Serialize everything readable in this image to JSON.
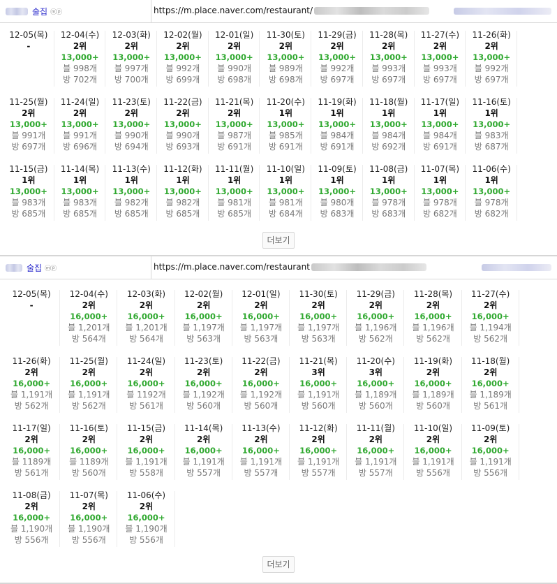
{
  "panels": [
    {
      "name": "술집",
      "badge": "ⓜⓟ",
      "url": "https://m.place.naver.com/restaurant/",
      "more_label": "더보기",
      "rows": [
        [
          {
            "date": "12-05(목)",
            "rank": "-",
            "price": "",
            "blog": "",
            "visit": ""
          },
          {
            "date": "12-04(수)",
            "rank": "2위",
            "price": "13,000+",
            "blog": "블 998개",
            "visit": "방 702개"
          },
          {
            "date": "12-03(화)",
            "rank": "2위",
            "price": "13,000+",
            "blog": "블 997개",
            "visit": "방 700개"
          },
          {
            "date": "12-02(월)",
            "rank": "2위",
            "price": "13,000+",
            "blog": "블 992개",
            "visit": "방 699개"
          },
          {
            "date": "12-01(일)",
            "rank": "2위",
            "price": "13,000+",
            "blog": "블 990개",
            "visit": "방 698개"
          },
          {
            "date": "11-30(토)",
            "rank": "2위",
            "price": "13,000+",
            "blog": "블 989개",
            "visit": "방 698개"
          },
          {
            "date": "11-29(금)",
            "rank": "2위",
            "price": "13,000+",
            "blog": "블 992개",
            "visit": "방 697개"
          },
          {
            "date": "11-28(목)",
            "rank": "2위",
            "price": "13,000+",
            "blog": "블 993개",
            "visit": "방 697개"
          },
          {
            "date": "11-27(수)",
            "rank": "2위",
            "price": "13,000+",
            "blog": "블 993개",
            "visit": "방 697개"
          },
          {
            "date": "11-26(화)",
            "rank": "2위",
            "price": "13,000+",
            "blog": "블 992개",
            "visit": "방 697개"
          }
        ],
        [
          {
            "date": "11-25(월)",
            "rank": "2위",
            "price": "13,000+",
            "blog": "블 991개",
            "visit": "방 697개"
          },
          {
            "date": "11-24(일)",
            "rank": "2위",
            "price": "13,000+",
            "blog": "블 991개",
            "visit": "방 696개"
          },
          {
            "date": "11-23(토)",
            "rank": "2위",
            "price": "13,000+",
            "blog": "블 990개",
            "visit": "방 694개"
          },
          {
            "date": "11-22(금)",
            "rank": "2위",
            "price": "13,000+",
            "blog": "블 990개",
            "visit": "방 693개"
          },
          {
            "date": "11-21(목)",
            "rank": "2위",
            "price": "13,000+",
            "blog": "블 987개",
            "visit": "방 691개"
          },
          {
            "date": "11-20(수)",
            "rank": "1위",
            "price": "13,000+",
            "blog": "블 985개",
            "visit": "방 691개"
          },
          {
            "date": "11-19(화)",
            "rank": "1위",
            "price": "13,000+",
            "blog": "블 984개",
            "visit": "방 691개"
          },
          {
            "date": "11-18(월)",
            "rank": "1위",
            "price": "13,000+",
            "blog": "블 984개",
            "visit": "방 692개"
          },
          {
            "date": "11-17(일)",
            "rank": "1위",
            "price": "13,000+",
            "blog": "블 984개",
            "visit": "방 691개"
          },
          {
            "date": "11-16(토)",
            "rank": "1위",
            "price": "13,000+",
            "blog": "블 983개",
            "visit": "방 687개"
          }
        ],
        [
          {
            "date": "11-15(금)",
            "rank": "1위",
            "price": "13,000+",
            "blog": "블 983개",
            "visit": "방 685개"
          },
          {
            "date": "11-14(목)",
            "rank": "1위",
            "price": "13,000+",
            "blog": "블 983개",
            "visit": "방 685개"
          },
          {
            "date": "11-13(수)",
            "rank": "1위",
            "price": "13,000+",
            "blog": "블 982개",
            "visit": "방 685개"
          },
          {
            "date": "11-12(화)",
            "rank": "1위",
            "price": "13,000+",
            "blog": "블 982개",
            "visit": "방 685개"
          },
          {
            "date": "11-11(월)",
            "rank": "1위",
            "price": "13,000+",
            "blog": "블 981개",
            "visit": "방 685개"
          },
          {
            "date": "11-10(일)",
            "rank": "1위",
            "price": "13,000+",
            "blog": "블 981개",
            "visit": "방 684개"
          },
          {
            "date": "11-09(토)",
            "rank": "1위",
            "price": "13,000+",
            "blog": "블 980개",
            "visit": "방 683개"
          },
          {
            "date": "11-08(금)",
            "rank": "1위",
            "price": "13,000+",
            "blog": "블 978개",
            "visit": "방 683개"
          },
          {
            "date": "11-07(목)",
            "rank": "1위",
            "price": "13,000+",
            "blog": "블 978개",
            "visit": "방 682개"
          },
          {
            "date": "11-06(수)",
            "rank": "1위",
            "price": "13,000+",
            "blog": "블 978개",
            "visit": "방 682개"
          }
        ]
      ]
    },
    {
      "name": "술집",
      "badge": "ⓜⓟ",
      "url": "https://m.place.naver.com/restaurant",
      "more_label": "더보기",
      "rows": [
        [
          {
            "date": "12-05(목)",
            "rank": "-",
            "price": "",
            "blog": "",
            "visit": ""
          },
          {
            "date": "12-04(수)",
            "rank": "2위",
            "price": "16,000+",
            "blog": "블 1,201개",
            "visit": "방 564개"
          },
          {
            "date": "12-03(화)",
            "rank": "2위",
            "price": "16,000+",
            "blog": "블 1,201개",
            "visit": "방 564개"
          },
          {
            "date": "12-02(월)",
            "rank": "2위",
            "price": "16,000+",
            "blog": "블 1,197개",
            "visit": "방 563개"
          },
          {
            "date": "12-01(일)",
            "rank": "2위",
            "price": "16,000+",
            "blog": "블 1,197개",
            "visit": "방 563개"
          },
          {
            "date": "11-30(토)",
            "rank": "2위",
            "price": "16,000+",
            "blog": "블 1,197개",
            "visit": "방 563개"
          },
          {
            "date": "11-29(금)",
            "rank": "2위",
            "price": "16,000+",
            "blog": "블 1,196개",
            "visit": "방 562개"
          },
          {
            "date": "11-28(목)",
            "rank": "2위",
            "price": "16,000+",
            "blog": "블 1,196개",
            "visit": "방 562개"
          },
          {
            "date": "11-27(수)",
            "rank": "2위",
            "price": "16,000+",
            "blog": "블 1,194개",
            "visit": "방 562개"
          }
        ],
        [
          {
            "date": "11-26(화)",
            "rank": "2위",
            "price": "16,000+",
            "blog": "블 1,191개",
            "visit": "방 562개"
          },
          {
            "date": "11-25(월)",
            "rank": "2위",
            "price": "16,000+",
            "blog": "블 1,191개",
            "visit": "방 562개"
          },
          {
            "date": "11-24(일)",
            "rank": "2위",
            "price": "16,000+",
            "blog": "블 1192개",
            "visit": "방 561개"
          },
          {
            "date": "11-23(토)",
            "rank": "2위",
            "price": "16,000+",
            "blog": "블 1,192개",
            "visit": "방 560개"
          },
          {
            "date": "11-22(금)",
            "rank": "2위",
            "price": "16,000+",
            "blog": "블 1,192개",
            "visit": "방 560개"
          },
          {
            "date": "11-21(목)",
            "rank": "3위",
            "price": "16,000+",
            "blog": "블 1,191개",
            "visit": "방 560개"
          },
          {
            "date": "11-20(수)",
            "rank": "3위",
            "price": "16,000+",
            "blog": "블 1,189개",
            "visit": "방 560개"
          },
          {
            "date": "11-19(화)",
            "rank": "2위",
            "price": "16,000+",
            "blog": "블 1,189개",
            "visit": "방 560개"
          },
          {
            "date": "11-18(월)",
            "rank": "2위",
            "price": "16,000+",
            "blog": "블 1,189개",
            "visit": "방 561개"
          }
        ],
        [
          {
            "date": "11-17(일)",
            "rank": "2위",
            "price": "16,000+",
            "blog": "블 1189개",
            "visit": "방 561개"
          },
          {
            "date": "11-16(토)",
            "rank": "2위",
            "price": "16,000+",
            "blog": "블 1189개",
            "visit": "방 560개"
          },
          {
            "date": "11-15(금)",
            "rank": "2위",
            "price": "16,000+",
            "blog": "블 1,191개",
            "visit": "방 558개"
          },
          {
            "date": "11-14(목)",
            "rank": "2위",
            "price": "16,000+",
            "blog": "블 1,191개",
            "visit": "방 557개"
          },
          {
            "date": "11-13(수)",
            "rank": "2위",
            "price": "16,000+",
            "blog": "블 1,191개",
            "visit": "방 557개"
          },
          {
            "date": "11-12(화)",
            "rank": "2위",
            "price": "16,000+",
            "blog": "블 1,191개",
            "visit": "방 557개"
          },
          {
            "date": "11-11(월)",
            "rank": "2위",
            "price": "16,000+",
            "blog": "블 1,191개",
            "visit": "방 557개"
          },
          {
            "date": "11-10(일)",
            "rank": "2위",
            "price": "16,000+",
            "blog": "블 1,191개",
            "visit": "방 556개"
          },
          {
            "date": "11-09(토)",
            "rank": "2위",
            "price": "16,000+",
            "blog": "블 1,191개",
            "visit": "방 556개"
          }
        ],
        [
          {
            "date": "11-08(금)",
            "rank": "2위",
            "price": "16,000+",
            "blog": "블 1,190개",
            "visit": "방 556개"
          },
          {
            "date": "11-07(목)",
            "rank": "2위",
            "price": "16,000+",
            "blog": "블 1,190개",
            "visit": "방 556개"
          },
          {
            "date": "11-06(수)",
            "rank": "2위",
            "price": "16,000+",
            "blog": "블 1,190개",
            "visit": "방 556개"
          }
        ]
      ]
    }
  ]
}
